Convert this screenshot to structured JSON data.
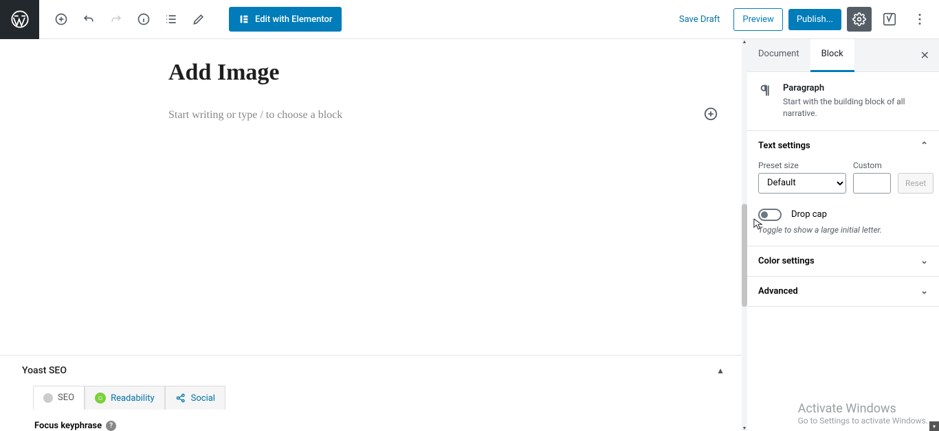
{
  "toolbar": {
    "elementor_label": "Edit with Elementor",
    "save_draft": "Save Draft",
    "preview": "Preview",
    "publish": "Publish..."
  },
  "editor": {
    "title": "Add Image",
    "paragraph_placeholder": "Start writing or type / to choose a block"
  },
  "yoast": {
    "panel_title": "Yoast SEO",
    "tab_seo": "SEO",
    "tab_readability": "Readability",
    "tab_social": "Social",
    "focus_keyphrase_label": "Focus keyphrase"
  },
  "sidebar": {
    "tab_document": "Document",
    "tab_block": "Block",
    "block_name": "Paragraph",
    "block_desc": "Start with the building block of all narrative.",
    "section_text": "Text settings",
    "preset_label": "Preset size",
    "preset_value": "Default",
    "custom_label": "Custom",
    "reset_label": "Reset",
    "dropcap_label": "Drop cap",
    "dropcap_help": "Toggle to show a large initial letter.",
    "section_color": "Color settings",
    "section_advanced": "Advanced"
  },
  "watermark": {
    "line1": "Activate Windows",
    "line2": "Go to Settings to activate Windows."
  }
}
